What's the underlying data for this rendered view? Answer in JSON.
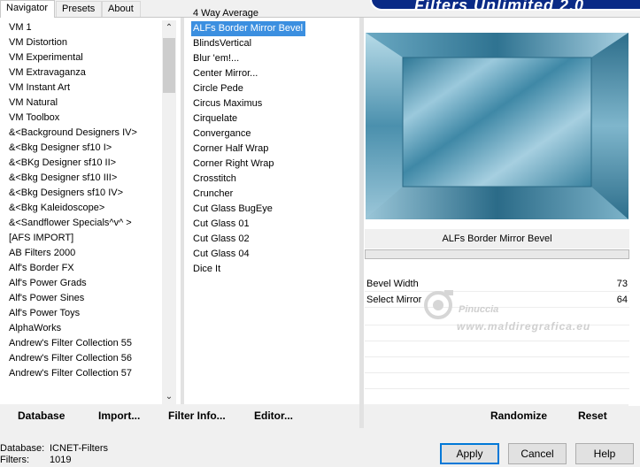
{
  "banner": "Filters Unlimited 2.0",
  "tabs": [
    "Navigator",
    "Presets",
    "About"
  ],
  "categories": [
    "VM 1",
    "VM Distortion",
    "VM Experimental",
    "VM Extravaganza",
    "VM Instant Art",
    "VM Natural",
    "VM Toolbox",
    "&<Background Designers IV>",
    "&<Bkg Designer sf10 I>",
    "&<BKg Designer sf10 II>",
    "&<Bkg Designer sf10 III>",
    "&<Bkg Designers sf10 IV>",
    "&<Bkg Kaleidoscope>",
    "&<Sandflower Specials^v^ >",
    "[AFS IMPORT]",
    "AB Filters 2000",
    "Alf's Border FX",
    "Alf's Power Grads",
    "Alf's Power Sines",
    "Alf's Power Toys",
    "AlphaWorks",
    "Andrew's Filter Collection 55",
    "Andrew's Filter Collection 56",
    "Andrew's Filter Collection 57"
  ],
  "filters": [
    "4 Way Average",
    "ALFs Border Mirror Bevel",
    "BlindsVertical",
    "Blur 'em!...",
    "Center Mirror...",
    "Circle Pede",
    "Circus Maximus",
    "Cirquelate",
    "Convergance",
    "Corner Half Wrap",
    "Corner Right Wrap",
    "Crosstitch",
    "Cruncher",
    "Cut Glass  BugEye",
    "Cut Glass 01",
    "Cut Glass 02",
    "Cut Glass 04",
    "Dice It"
  ],
  "selected_filter": "ALFs Border Mirror Bevel",
  "params_title": "ALFs Border Mirror Bevel",
  "params": [
    {
      "label": "Bevel Width",
      "value": "73"
    },
    {
      "label": "Select Mirror",
      "value": "64"
    }
  ],
  "watermark": {
    "line1": "Pinuccia",
    "line2": "www.maldiregrafica.eu"
  },
  "left_buttons": [
    "Database",
    "Import...",
    "Filter Info...",
    "Editor..."
  ],
  "right_buttons": [
    "Randomize",
    "Reset"
  ],
  "status": {
    "database_label": "Database:",
    "database_value": "ICNET-Filters",
    "filters_label": "Filters:",
    "filters_value": "1019"
  },
  "dialog_buttons": {
    "apply": "Apply",
    "cancel": "Cancel",
    "help": "Help"
  },
  "icons": {
    "scroll_up": "chevron-up-icon",
    "scroll_down": "chevron-down-icon"
  },
  "colors": {
    "selection": "#3b8fe0",
    "banner": "#0a2a86",
    "preview": "#4f93b2"
  }
}
